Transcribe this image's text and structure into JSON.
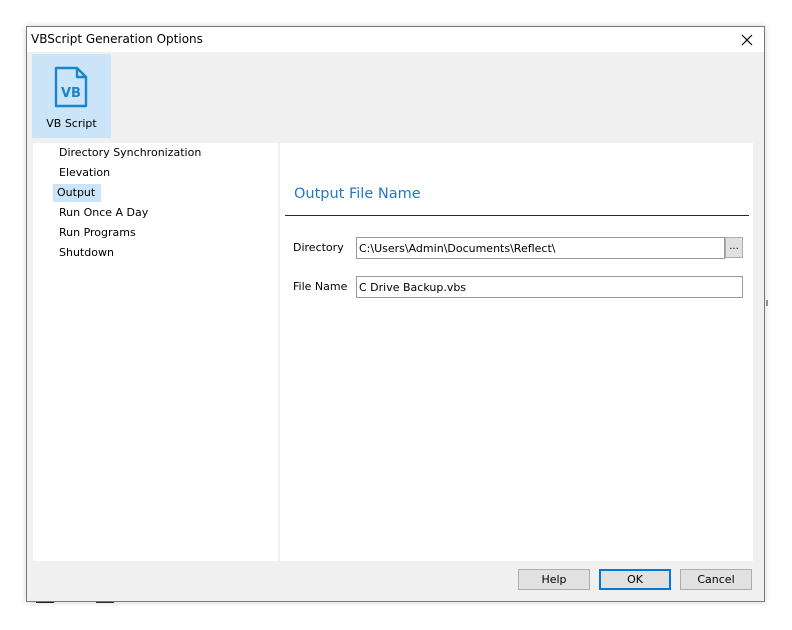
{
  "window": {
    "title": "VBScript Generation Options"
  },
  "toolbar": {
    "items": [
      {
        "label": "VB Script",
        "icon": "vb-script-file-icon",
        "icon_text": "VB"
      }
    ]
  },
  "nav": {
    "items": [
      {
        "label": "Directory Synchronization"
      },
      {
        "label": "Elevation"
      },
      {
        "label": "Output",
        "selected": true
      },
      {
        "label": "Run Once A Day"
      },
      {
        "label": "Run Programs"
      },
      {
        "label": "Shutdown"
      }
    ]
  },
  "content": {
    "heading": "Output File Name",
    "directory": {
      "label": "Directory",
      "value": "C:\\Users\\Admin\\Documents\\Reflect\\",
      "browse_label": "..."
    },
    "filename": {
      "label": "File Name",
      "value": "C Drive Backup.vbs"
    }
  },
  "buttons": {
    "help": "Help",
    "ok": "OK",
    "cancel": "Cancel"
  },
  "colors": {
    "accent": "#1e7ac8",
    "selection": "#cce4f7",
    "default_button_border": "#0078d7"
  }
}
